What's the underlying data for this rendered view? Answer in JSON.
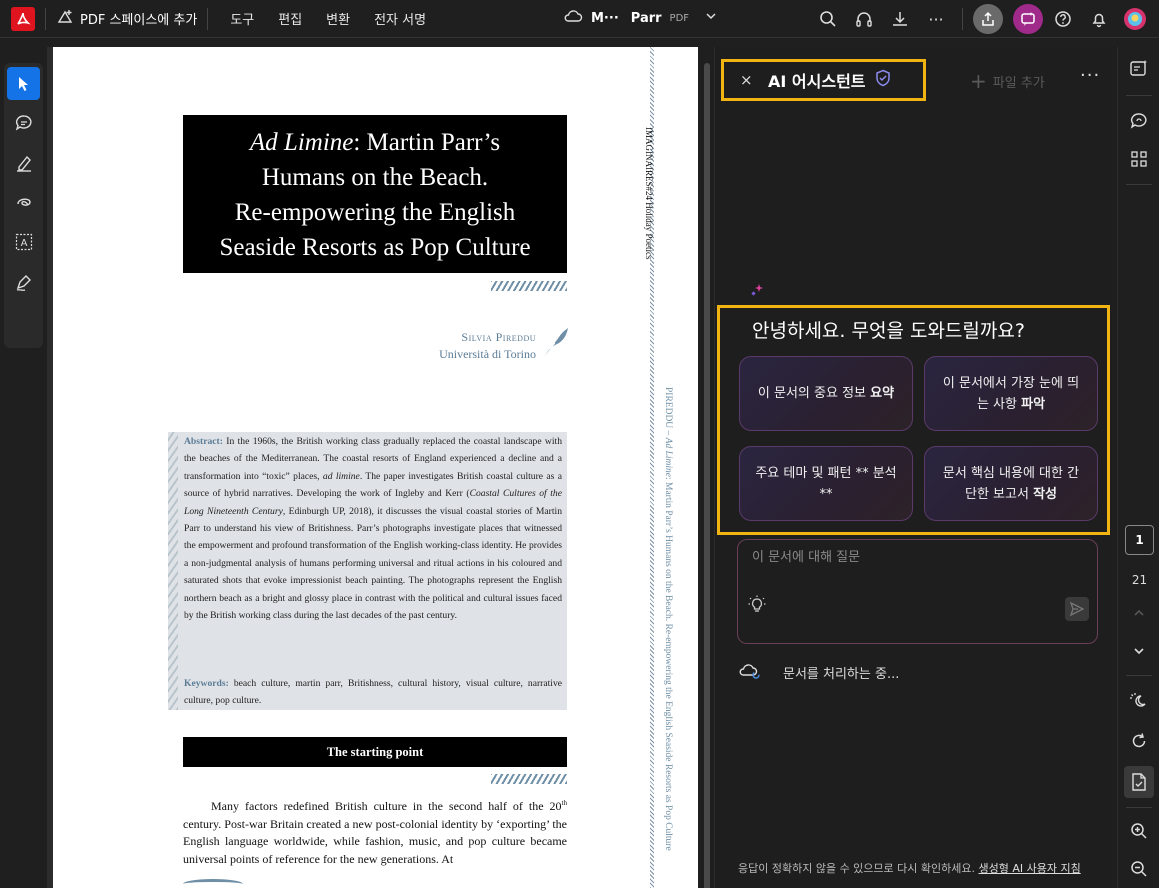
{
  "topbar": {
    "add_to_space": "PDF 스페이스에 추가",
    "menu": [
      "도구",
      "편집",
      "변환",
      "전자 서명"
    ],
    "doc_name_short": "M···",
    "doc_name": "Parr",
    "doc_type": "PDF"
  },
  "document": {
    "title_italic": "Ad Limine",
    "title_line1_rest": ": Martin Parr’s",
    "title_line2": "Humans on the Beach.",
    "title_line3": "Re-empowering the English",
    "title_line4": "Seaside Resorts as Pop Culture",
    "author": "Silvia Pireddu",
    "affiliation": "Università di Torino",
    "abstract_label": "Abstract:",
    "abstract_text_a": "In the 1960s, the British working class gradually replaced the coastal landscape with the beaches of the Mediterranean. The coastal resorts of England experienced a decline and a transformation into “toxic” places,",
    "abstract_italic_1": "ad limine",
    "abstract_text_b": ". The paper investigates British coastal culture as a source of hybrid narratives. Developing the work of Ingleby and Kerr (",
    "abstract_italic_2": "Coastal Cultures of the Long Nineteenth Century",
    "abstract_text_c": ", Edinburgh UP, 2018), it discusses the visual coastal stories of Martin Parr to understand his view of Britishness. Parr’s photographs investigate places that witnessed the empowerment and profound transformation of the English working-class identity. He provides a non-judgmental analysis of humans performing universal and ritual actions in his coloured and saturated shots that evoke impressionist beach painting. The photographs represent the English northern beach as a bright and glossy place in contrast with the political and cultural issues faced by the British working class during the last decades of the past century.",
    "keywords_label": "Keywords:",
    "keywords_text": "beach culture, martin parr, Britishness, cultural history, visual culture, narrative culture, pop culture.",
    "section_heading": "The starting point",
    "body_text_a": "Many factors redefined British culture in the second half of the 20",
    "body_sup": "th",
    "body_text_b": " century. Post-war Britain created a new post-colonial identity by ‘exporting’ the English language worldwide, while fashion, music, and pop culture became universal points of reference for the new generations. At",
    "vertical_journal": "IMAGINAIRES#24  Holiday Poetics",
    "vertical_running_prefix": "PIREDDU – ",
    "vertical_running_italic": "Ad Limine",
    "vertical_running_rest": ": Martin Parr’s Humans on the Beach. Re-empowering the English Seaside Resorts as Pop Culture"
  },
  "assistant": {
    "close": "×",
    "title": "AI 어시스턴트",
    "add_file": "파일 추가",
    "more": "···",
    "greeting": "안녕하세요. 무엇을 도와드릴까요?",
    "suggestions": [
      {
        "text": "이 문서의 중요 정보 ",
        "bold": "요약"
      },
      {
        "text": "이 문서에서 가장 눈에 띄는 사항 ",
        "bold": "파악"
      },
      {
        "text": "주요 테마 및 패턴 ** 분석**",
        "bold": ""
      },
      {
        "text": "문서 핵심 내용에 대한 간단한 보고서 ",
        "bold": "작성"
      }
    ],
    "input_placeholder": "이 문서에 대해 질문",
    "processing": "문서를 처리하는 중...",
    "disclaimer": "응답이 정확하지 않을 수 있으므로 다시 확인하세요.",
    "disclaimer_link": "생성형 AI 사용자 지침"
  },
  "rail": {
    "current_page": "1",
    "total_pages": "21"
  },
  "colors": {
    "accent_yellow": "#f2b412",
    "acrobat_red": "#e0141e",
    "tool_active": "#1473e6",
    "journal_blue": "#5b7c96"
  }
}
